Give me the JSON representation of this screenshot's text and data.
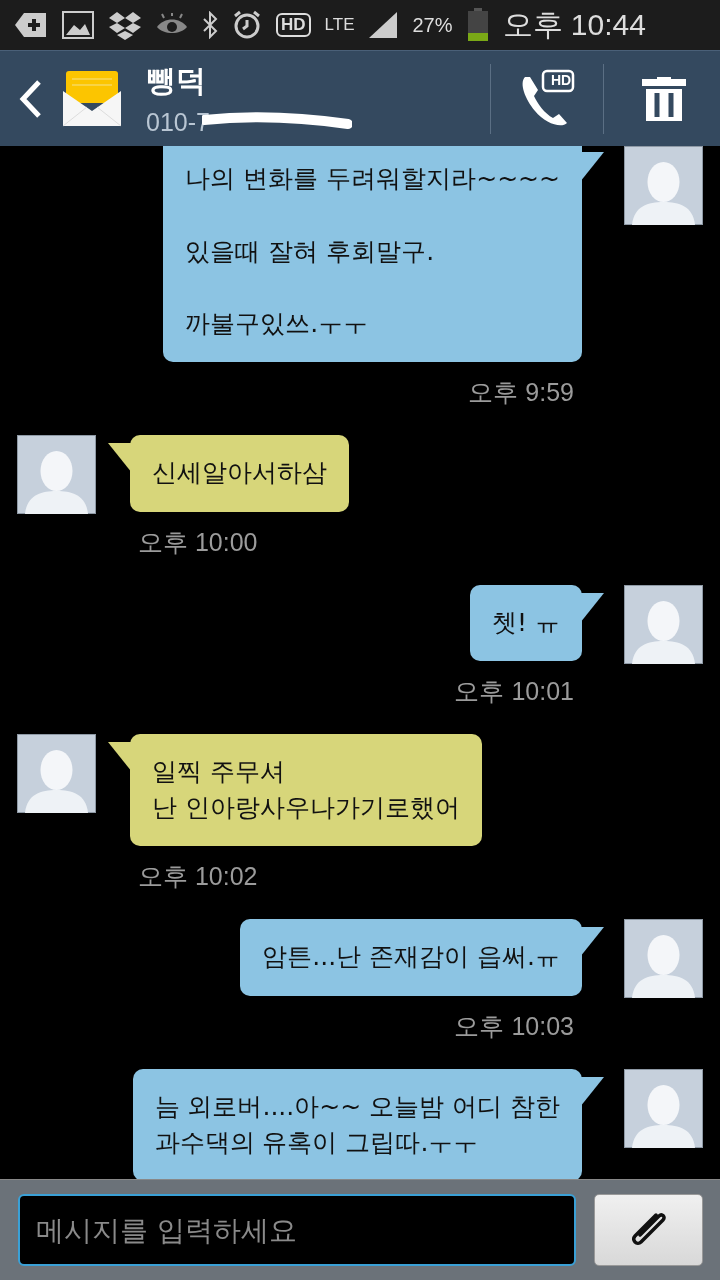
{
  "status_bar": {
    "hd_badge": "HD",
    "network": "LTE",
    "battery": "27%",
    "time": "오후 10:44"
  },
  "header": {
    "name": "뺑덕",
    "number": "010-7",
    "call_badge": "HD"
  },
  "messages": [
    {
      "kind": "sent",
      "text": "나의 변화를 두려워할지라~~~~\n\n있을때 잘혀 후회말구.\n\n까불구있쓰.ㅜㅜ",
      "time": "오후 9:59"
    },
    {
      "kind": "received",
      "text": "신세알아서하삼",
      "time": "오후 10:00"
    },
    {
      "kind": "sent",
      "text": "쳇!  ㅠ",
      "time": "오후 10:01"
    },
    {
      "kind": "received",
      "text": "일찍 주무셔\n난 인아랑사우나가기로했어",
      "time": "오후 10:02"
    },
    {
      "kind": "sent",
      "text": "암튼...난 존재감이 읍써.ㅠ",
      "time": "오후 10:03"
    },
    {
      "kind": "sent",
      "text": "늠 외로버....아~~ 오늘밤 어디 참한\n과수댁의 유혹이 그립따.ㅜㅜ"
    }
  ],
  "composer": {
    "placeholder": "메시지를 입력하세요"
  }
}
